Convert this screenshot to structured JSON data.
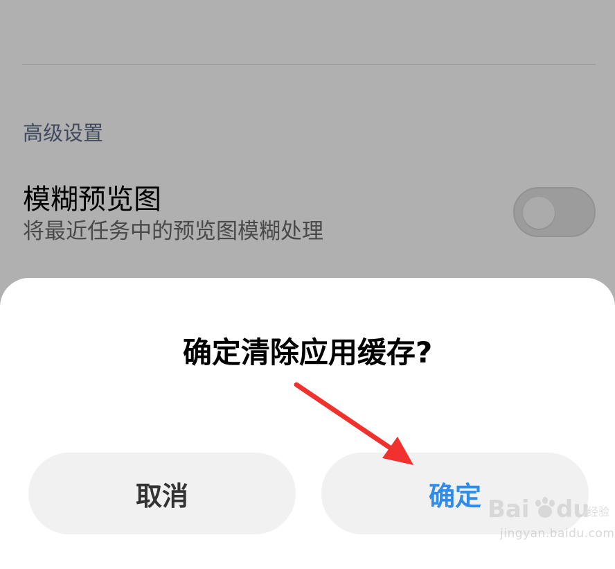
{
  "background": {
    "section_header": "高级设置",
    "blur_preview": {
      "title": "模糊预览图",
      "description": "将最近任务中的预览图模糊处理",
      "toggle_state": "off"
    }
  },
  "dialog": {
    "title": "确定清除应用缓存?",
    "cancel_label": "取消",
    "confirm_label": "确定"
  },
  "watermark": {
    "logo_text": "Bai du 经验",
    "url": "jingyan.baidu.com"
  },
  "colors": {
    "accent": "#2f8ce8",
    "arrow": "#f0312d",
    "section_header": "#5d6c86"
  },
  "icons": {
    "annotation": "red-arrow-icon"
  }
}
